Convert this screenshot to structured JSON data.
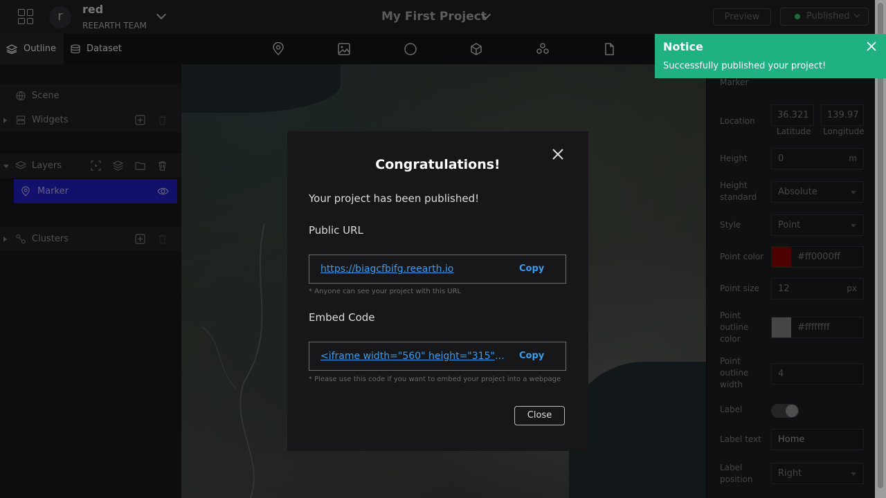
{
  "header": {
    "user_initial": "r",
    "user_name": "red",
    "team_name": "REEARTH TEAM",
    "project_title": "My First Project",
    "preview_label": "Preview",
    "published_label": "Published"
  },
  "toolbar": {
    "tabs": [
      {
        "label": "Outline"
      },
      {
        "label": "Dataset"
      }
    ],
    "tools": [
      "marker-icon",
      "image-icon",
      "sphere-icon",
      "model-icon",
      "cluster-icon",
      "file-icon"
    ]
  },
  "outline": {
    "scene_label": "Scene",
    "widgets_label": "Widgets",
    "layers_label": "Layers",
    "marker_label": "Marker",
    "clusters_label": "Clusters"
  },
  "properties": {
    "title": "Marker",
    "location_label": "Location",
    "latitude_value": "36.321",
    "longitude_value": "139.97",
    "latitude_caption": "Latitude",
    "longitude_caption": "Longitude",
    "height_label": "Height",
    "height_value": "0",
    "height_unit": "m",
    "height_standard_label": "Height standard",
    "height_standard_value": "Absolute",
    "style_label": "Style",
    "style_value": "Point",
    "point_color_label": "Point color",
    "point_color_value": "#ff0000ff",
    "point_size_label": "Point size",
    "point_size_value": "12",
    "point_size_unit": "px",
    "point_outline_color_label": "Point outline color",
    "point_outline_color_value": "#ffffffff",
    "point_outline_width_label": "Point outline width",
    "point_outline_width_value": "4",
    "label_label": "Label",
    "label_text_label": "Label text",
    "label_text_value": "Home",
    "label_position_label": "Label position",
    "label_position_value": "Right"
  },
  "notice": {
    "title": "Notice",
    "message": "Successfully published your project!"
  },
  "modal": {
    "title": "Congratulations!",
    "subtitle": "Your project has been published!",
    "public_url_heading": "Public URL",
    "public_url": "https://biagcfbifg.reearth.io",
    "copy_label": "Copy",
    "public_url_hint": "* Anyone can see your project with this URL",
    "embed_heading": "Embed Code",
    "embed_code": "<iframe width=\"560\" height=\"315\" src=...",
    "embed_hint": "* Please use this code if you want to embed your project into a webpage",
    "close_label": "Close"
  },
  "colors": {
    "notice_bg": "#1fb181",
    "link": "#3a9cf0",
    "selected_layer": "#1c1aa3",
    "published_dot": "#2aa46a"
  }
}
